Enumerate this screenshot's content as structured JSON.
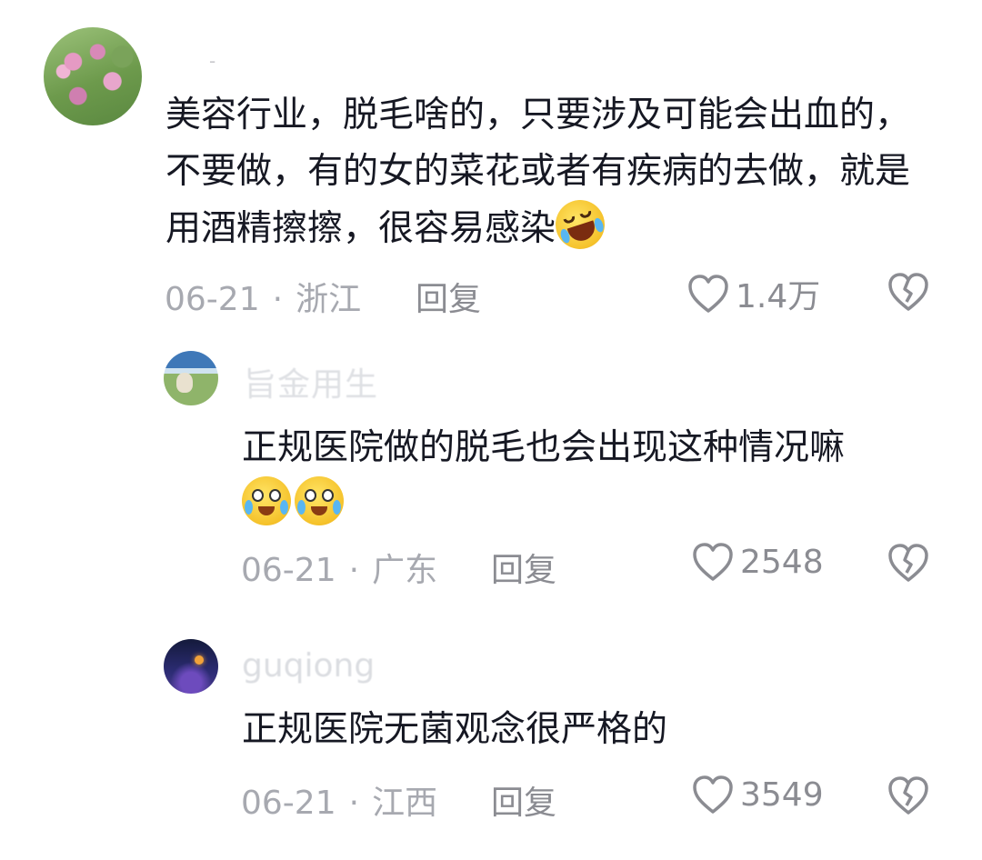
{
  "comments": [
    {
      "username": "-",
      "text": "美容行业，脱毛啥的，只要涉及可能会出血的，不要做，有的女的菜花或者有疾病的去做，就是用酒精擦擦，很容易感染",
      "date": "06-21",
      "separator": "·",
      "location": "浙江",
      "reply_label": "回复",
      "likes": "1.4万"
    },
    {
      "username": "旨金用生",
      "text": "正规医院做的脱毛也会出现这种情况嘛",
      "date": "06-21",
      "separator": "·",
      "location": "广东",
      "reply_label": "回复",
      "likes": "2548"
    },
    {
      "username": "guqiong",
      "text": "正规医院无菌观念很严格的",
      "date": "06-21",
      "separator": "·",
      "location": "江西",
      "reply_label": "回复",
      "likes": "3549"
    }
  ],
  "icons": {
    "like": "heart-outline-icon",
    "dislike": "broken-heart-outline-icon",
    "emoji_laugh": "rolling-laugh-emoji",
    "emoji_tears": "tears-of-joy-emoji"
  },
  "colors": {
    "text": "#161823",
    "meta": "#a7a9b0",
    "action": "#8b8c92"
  }
}
